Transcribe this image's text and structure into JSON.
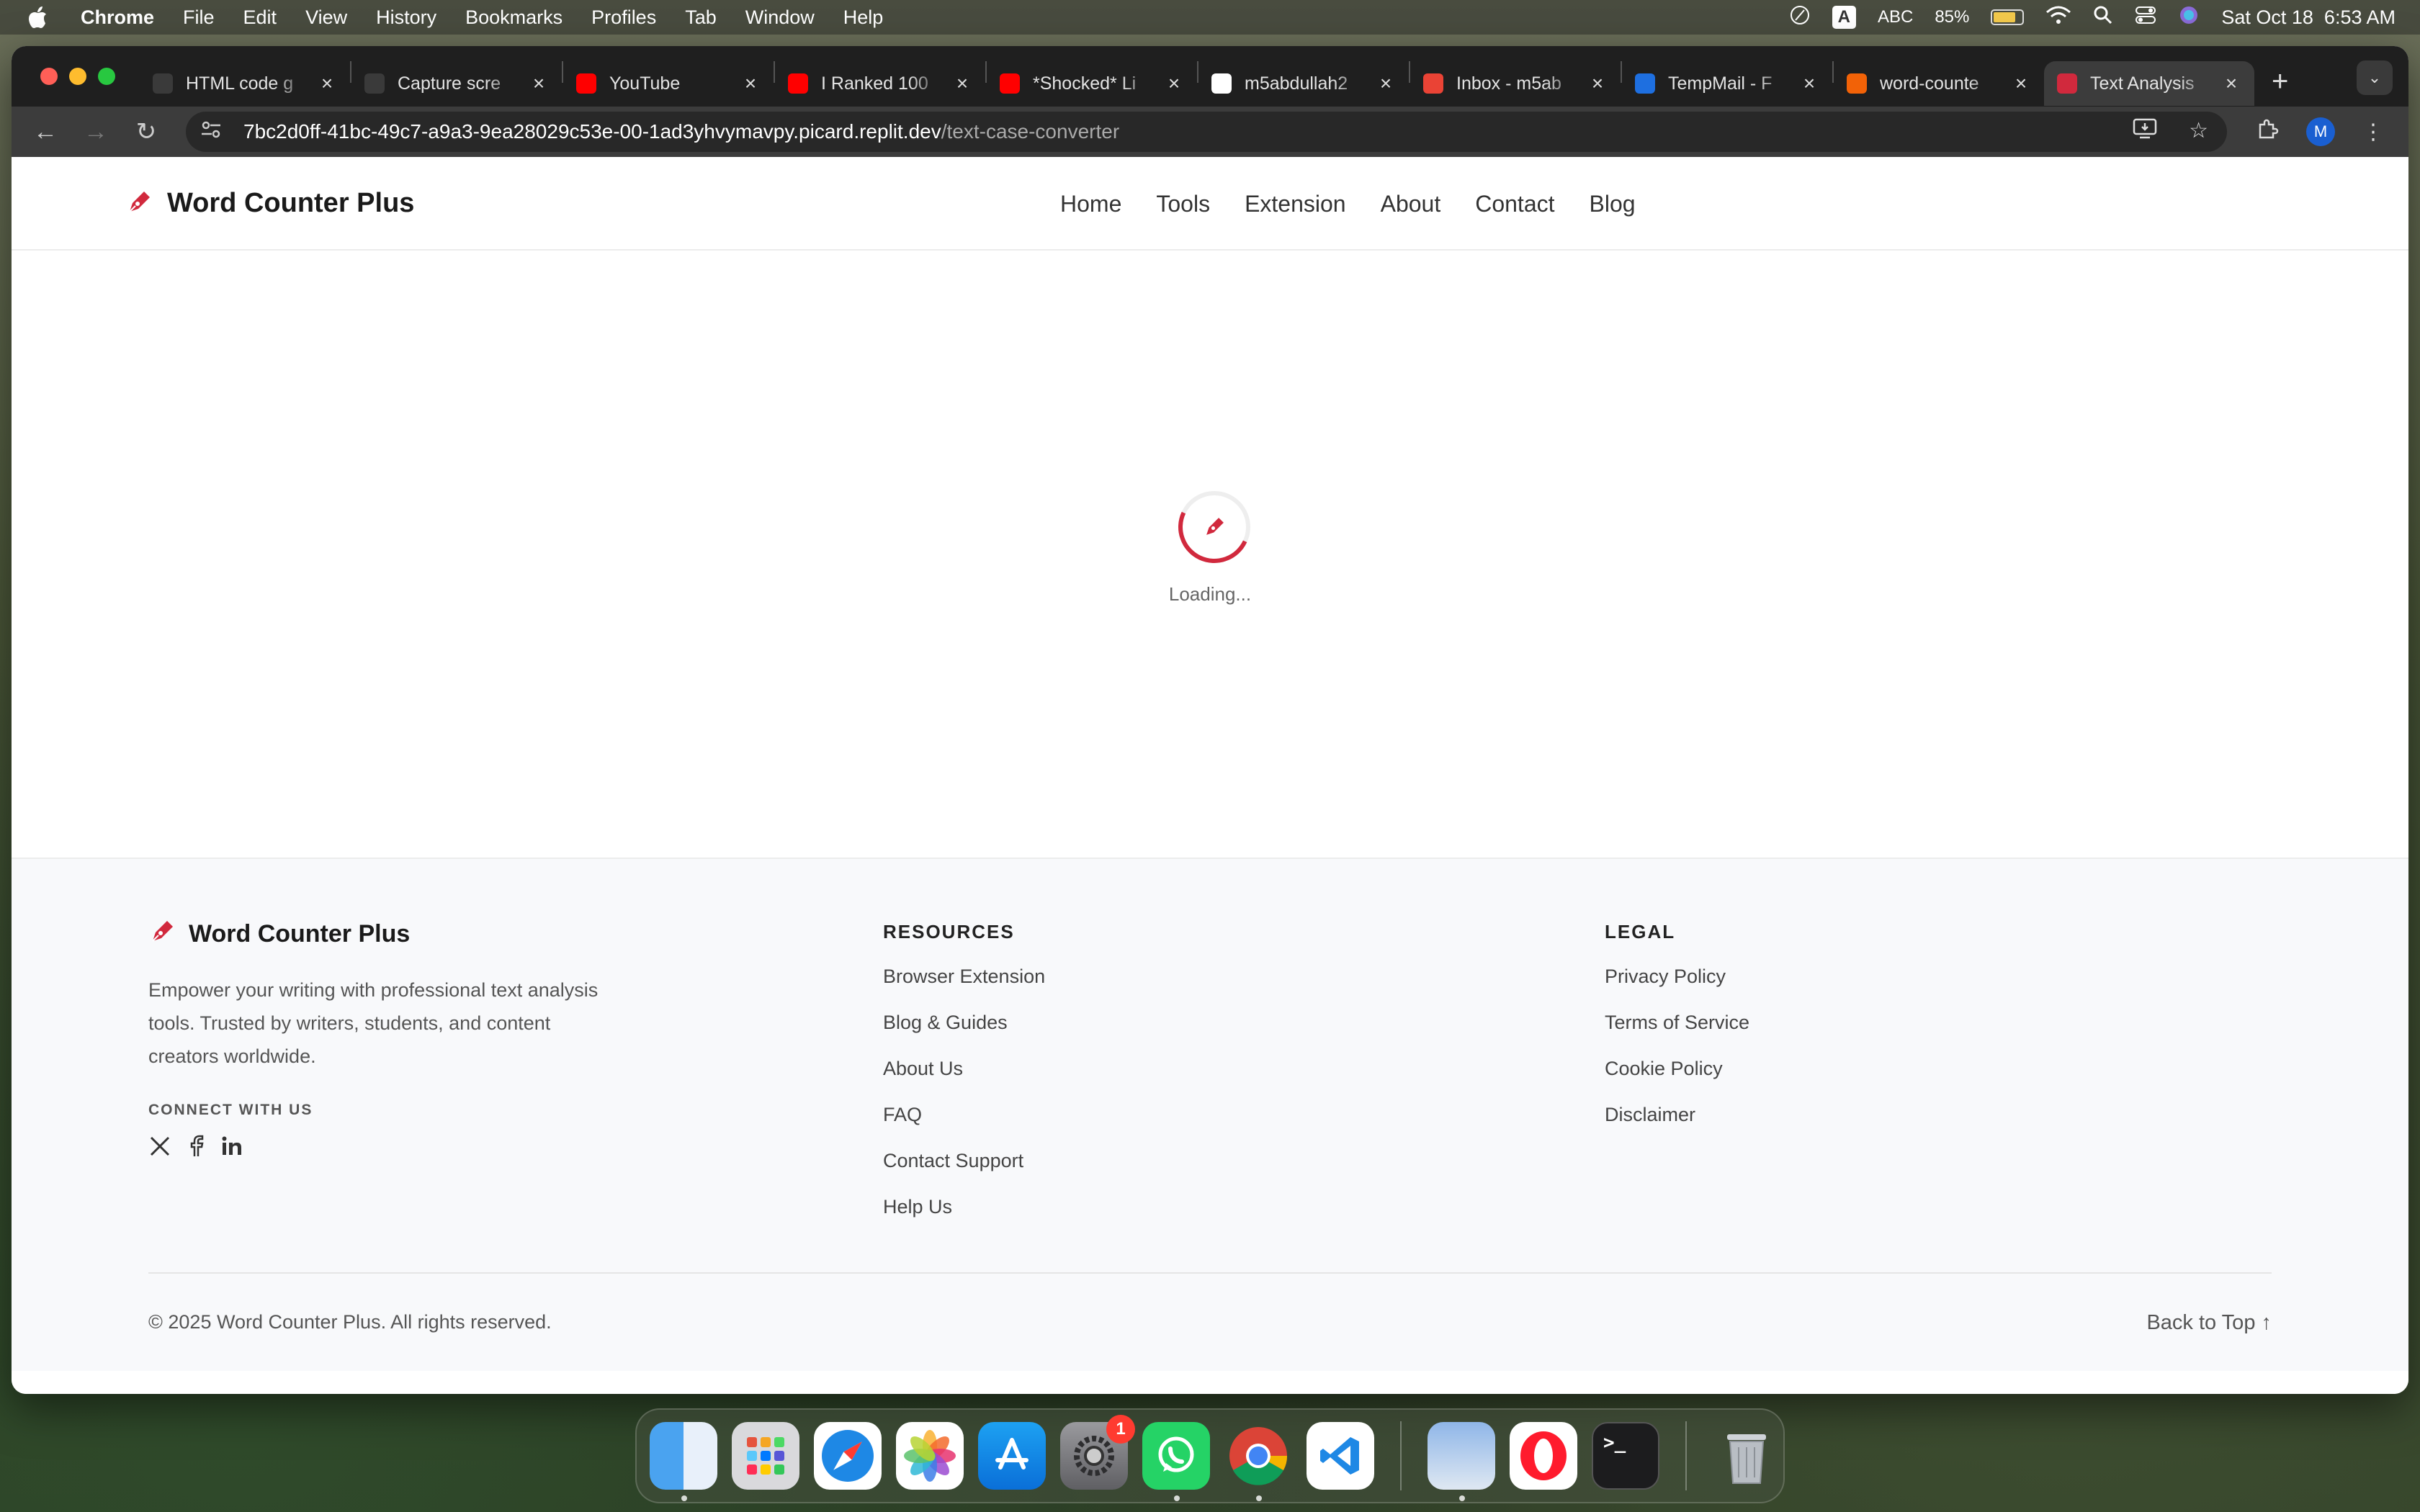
{
  "menubar": {
    "app": "Chrome",
    "items": [
      "File",
      "Edit",
      "View",
      "History",
      "Bookmarks",
      "Profiles",
      "Tab",
      "Window",
      "Help"
    ],
    "input_source": "ABC",
    "input_badge": "A",
    "battery": "85%",
    "datetime": "Sat Oct 18  6:53 AM"
  },
  "browser": {
    "tabs": [
      {
        "title": "HTML code g",
        "icon": "chatgpt-icon",
        "color": "#3a3a3a"
      },
      {
        "title": "Capture scre",
        "icon": "chatgpt-icon",
        "color": "#3a3a3a"
      },
      {
        "title": "YouTube",
        "icon": "youtube-icon",
        "color": "#ff0000"
      },
      {
        "title": "I Ranked 100",
        "icon": "youtube-icon",
        "color": "#ff0000"
      },
      {
        "title": "*Shocked* Li",
        "icon": "youtube-icon",
        "color": "#ff0000"
      },
      {
        "title": "m5abdullah2",
        "icon": "github-icon",
        "color": "#ffffff"
      },
      {
        "title": "Inbox - m5ab",
        "icon": "gmail-icon",
        "color": "#ea4335"
      },
      {
        "title": "TempMail - F",
        "icon": "tempmail-icon",
        "color": "#1e6fe0"
      },
      {
        "title": "word-counte",
        "icon": "replit-icon",
        "color": "#f26207"
      },
      {
        "title": "Text Analysis",
        "icon": "pen-icon",
        "color": "#d1293d",
        "active": true
      }
    ],
    "url_host": "7bc2d0ff-41bc-49c7-a9a3-9ea28029c53e-00-1ad3yhvymavpy.picard.replit.dev",
    "url_path": "/text-case-converter",
    "profile_initial": "M"
  },
  "site": {
    "brand": "Word Counter Plus",
    "nav": [
      "Home",
      "Tools",
      "Extension",
      "About",
      "Contact",
      "Blog"
    ],
    "loading_text": "Loading...",
    "accent_color": "#d1293d"
  },
  "footer": {
    "brand": "Word Counter Plus",
    "description": "Empower your writing with professional text analysis tools. Trusted by writers, students, and content creators worldwide.",
    "connect_label": "CONNECT WITH US",
    "resources_title": "RESOURCES",
    "resources": [
      "Browser Extension",
      "Blog & Guides",
      "About Us",
      "FAQ",
      "Contact Support",
      "Help Us"
    ],
    "legal_title": "LEGAL",
    "legal": [
      "Privacy Policy",
      "Terms of Service",
      "Cookie Policy",
      "Disclaimer"
    ],
    "copyright": "© 2025 Word Counter Plus. All rights reserved.",
    "back_to_top": "Back to Top ↑"
  },
  "dock": {
    "apps": [
      "Finder",
      "Launchpad",
      "Safari",
      "Photos",
      "App Store",
      "System Settings",
      "WhatsApp",
      "Google Chrome",
      "Visual Studio Code",
      "Preview",
      "Opera",
      "Terminal",
      "Trash"
    ],
    "settings_badge": "1"
  }
}
